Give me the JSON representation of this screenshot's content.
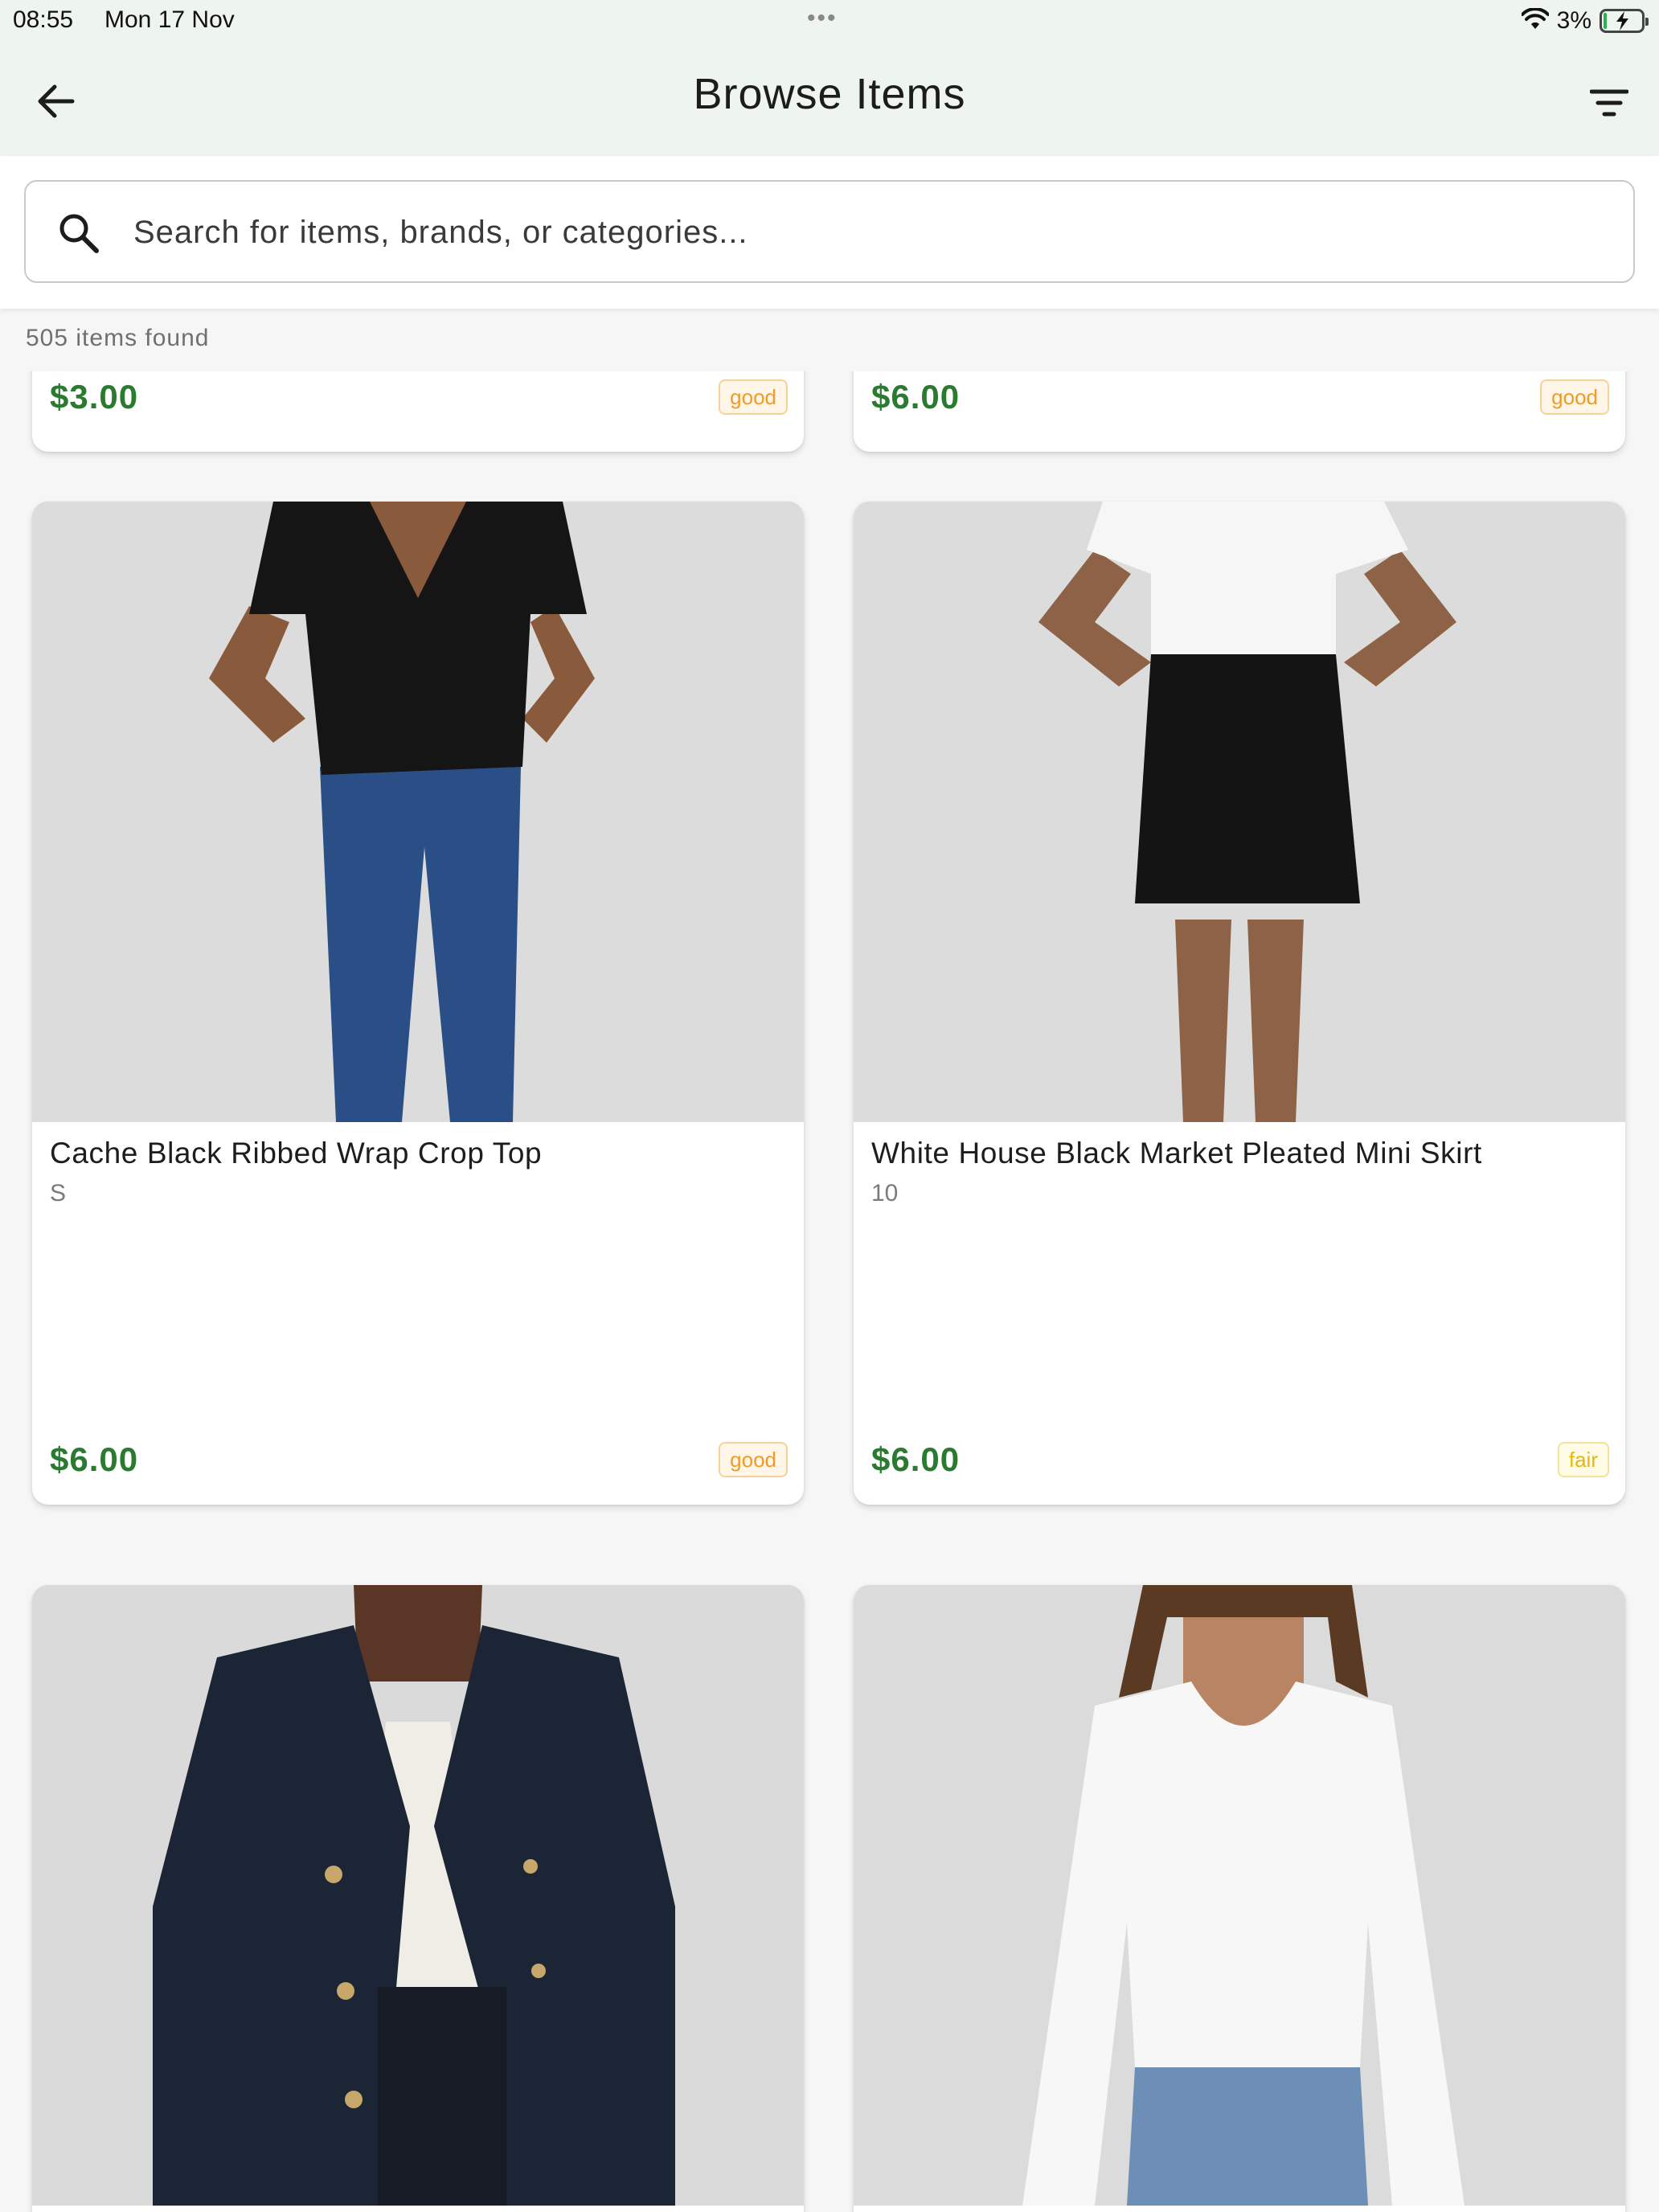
{
  "status_bar": {
    "time": "08:55",
    "date": "Mon 17 Nov",
    "dots": "•••",
    "battery": "3%"
  },
  "app_bar": {
    "title": "Browse Items",
    "back_icon": "arrow-left-icon",
    "filter_icon": "filter-lines-icon"
  },
  "search": {
    "placeholder": "Search for items, brands, or categories...",
    "value": ""
  },
  "results": {
    "count_text": "505 items found"
  },
  "colors": {
    "price_green": "#2a7a30",
    "badge_good": "#ef9b2a",
    "badge_fair": "#e6b712",
    "app_bar_bg": "#eef4ee"
  },
  "items": [
    {
      "title": "",
      "size": "",
      "price": "$3.00",
      "condition": "good"
    },
    {
      "title": "",
      "size": "",
      "price": "$6.00",
      "condition": "good"
    },
    {
      "title": "Cache Black Ribbed Wrap Crop Top",
      "size": "S",
      "price": "$6.00",
      "condition": "good"
    },
    {
      "title": "White House Black Market Pleated Mini Skirt",
      "size": "10",
      "price": "$6.00",
      "condition": "fair"
    },
    {
      "title": "",
      "size": "",
      "price": "",
      "condition": ""
    },
    {
      "title": "",
      "size": "",
      "price": "",
      "condition": ""
    }
  ]
}
